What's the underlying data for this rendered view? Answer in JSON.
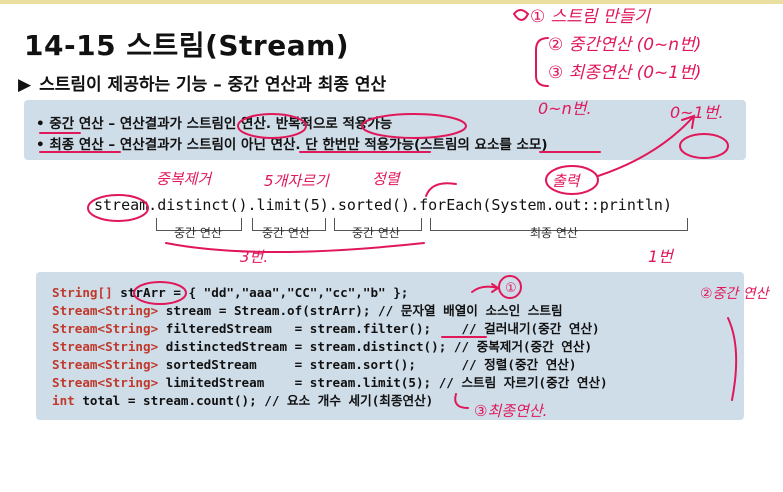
{
  "title": "14-15 스트림(Stream)",
  "subtitle": "스트림이 제공하는 기능 – 중간 연산과 최종 연산",
  "info": {
    "line1": "• 중간 연산 – 연산결과가 스트림인 연산. 반복적으로 적용가능",
    "line2": "• 최종 연산 – 연산결과가 스트림이 아닌 연산. 단 한번만 적용가능(스트림의 요소를 소모)"
  },
  "chain": {
    "code": "stream.distinct().limit(5).sorted().forEach(System.out::println)",
    "labels": [
      "중간 연산",
      "중간 연산",
      "중간 연산",
      "최종 연산"
    ]
  },
  "code_lines": [
    {
      "type": "String[]",
      "rest": " strArr = { \"dd\",\"aaa\",\"CC\",\"cc\",\"b\" };"
    },
    {
      "type": "Stream<String>",
      "rest": " stream = Stream.of(strArr); // 문자열 배열이 소스인 스트림"
    },
    {
      "type": "Stream<String>",
      "rest": " filteredStream   = stream.filter();    // 걸러내기(중간 연산)"
    },
    {
      "type": "Stream<String>",
      "rest": " distinctedStream = stream.distinct(); // 중복제거(중간 연산)"
    },
    {
      "type": "Stream<String>",
      "rest": " sortedStream     = stream.sort();      // 정렬(중간 연산)"
    },
    {
      "type": "Stream<String>",
      "rest": " limitedStream    = stream.limit(5); // 스트림 자르기(중간 연산)"
    },
    {
      "type": "int",
      "rest": " total = stream.count(); // 요소 개수 세기(최종연산)"
    }
  ],
  "annotations": {
    "note1": "① 스트림 만들기",
    "note2": "② 중간연산 (0~n번)",
    "note3": "③ 최종연산 (0~1번)",
    "zero_n": "0~n번.",
    "zero_one": "0~1번.",
    "dedup": "중복제거",
    "five": "5개자르기",
    "sort": "정렬",
    "output": "출력",
    "three_times": "3번.",
    "once": "1번",
    "circle1": "①",
    "mid_label": "②중간 연산",
    "final_label": "③최종연산."
  }
}
